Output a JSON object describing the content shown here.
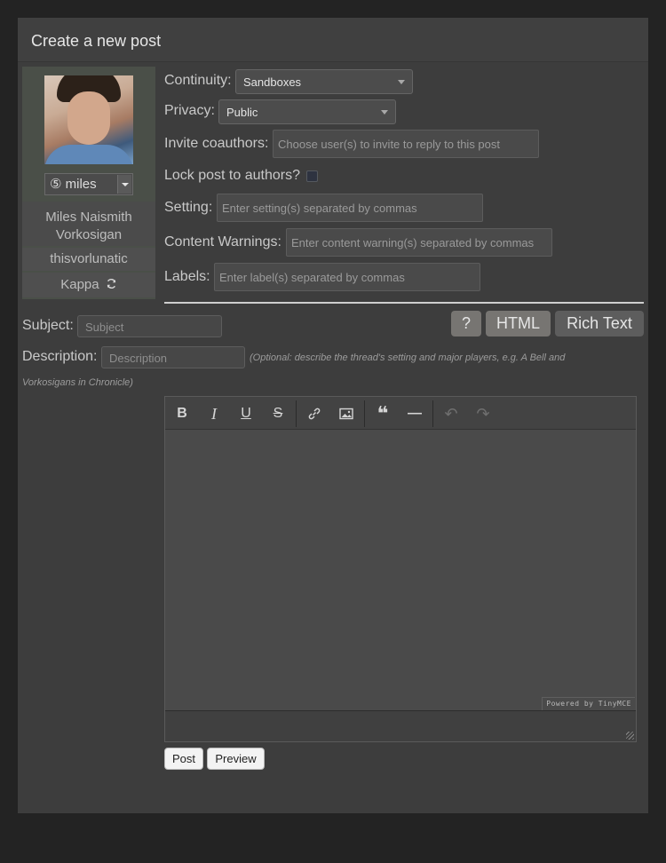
{
  "header": {
    "title": "Create a new post"
  },
  "character": {
    "alias_selected": "⑤ miles",
    "name": "Miles Naismith Vorkosigan",
    "username": "thisvorlunatic",
    "board": "Kappa",
    "refresh_icon": "refresh-icon"
  },
  "form": {
    "continuity_label": "Continuity:",
    "continuity_value": "Sandboxes",
    "privacy_label": "Privacy:",
    "privacy_value": "Public",
    "coauthors_label": "Invite coauthors:",
    "coauthors_placeholder": "Choose user(s) to invite to reply to this post",
    "lock_label": "Lock post to authors?",
    "setting_label": "Setting:",
    "setting_placeholder": "Enter setting(s) separated by commas",
    "warnings_label": "Content Warnings:",
    "warnings_placeholder": "Enter content warning(s) separated by commas",
    "labels_label": "Labels:",
    "labels_placeholder": "Enter label(s) separated by commas",
    "subject_label": "Subject:",
    "subject_placeholder": "Subject",
    "description_label": "Description:",
    "description_placeholder": "Description",
    "description_hint": "(Optional: describe the thread's setting and major players, e.g. A Bell and",
    "description_hint_2": "Vorkosigans in Chronicle)"
  },
  "editor_modes": {
    "help": "?",
    "html": "HTML",
    "rich": "Rich Text"
  },
  "toolbar": {
    "bold": "B",
    "italic": "I",
    "underline": "U",
    "strike": "S",
    "link_icon": "link-icon",
    "image_icon": "image-icon",
    "quote": "❝",
    "hr": "—",
    "undo": "↶",
    "redo": "↷"
  },
  "editor": {
    "powered_by": "Powered by TinyMCE"
  },
  "actions": {
    "post": "Post",
    "preview": "Preview"
  }
}
